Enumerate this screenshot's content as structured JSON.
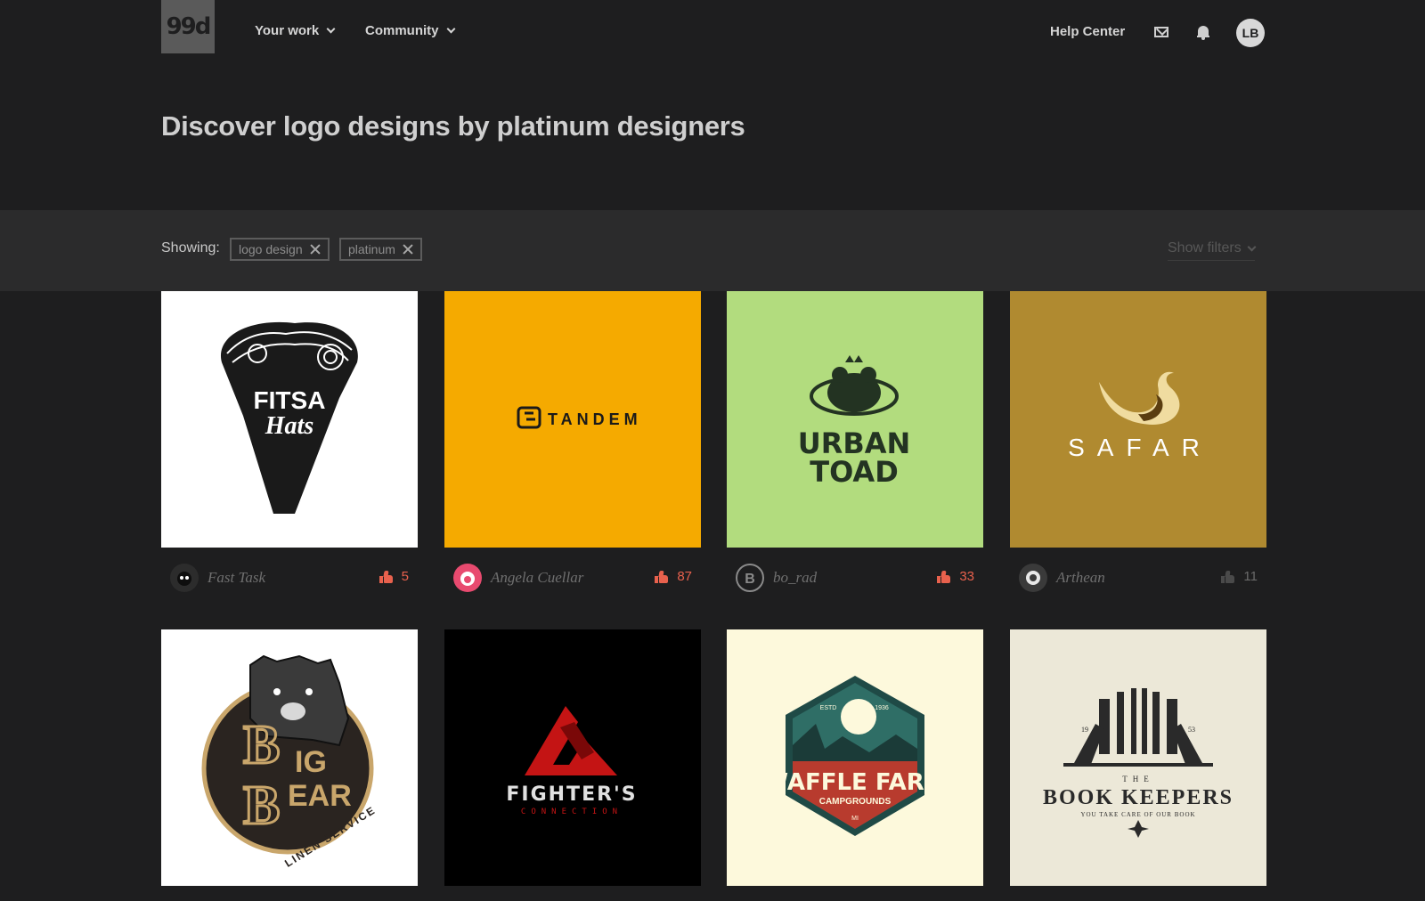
{
  "header": {
    "logo_text": "99d",
    "nav": [
      {
        "label": "Your work"
      },
      {
        "label": "Community"
      }
    ],
    "help_label": "Help Center",
    "icons": [
      "mail-icon",
      "bell-icon"
    ],
    "avatar_initials": "LB"
  },
  "page": {
    "title": "Discover logo designs by platinum designers"
  },
  "filters": {
    "showing_label": "Showing:",
    "chips": [
      "logo design",
      "platinum"
    ],
    "show_filters_label": "Show filters"
  },
  "designs": [
    {
      "designer": "Fast Task",
      "likes": "5",
      "bg": "#ffffff",
      "logo_text": "FITSA",
      "logo_text2": "Hats"
    },
    {
      "designer": "Angela Cuellar",
      "likes": "87",
      "bg": "#f5aa00",
      "logo_text": "TANDEM"
    },
    {
      "designer": "bo_rad",
      "likes": "33",
      "bg": "#b2dc7e",
      "logo_text": "URBAN",
      "logo_text2": "TOAD"
    },
    {
      "designer": "Arthean",
      "likes": "11",
      "bg": "#b08a30",
      "logo_text": "SAFAR"
    },
    {
      "bg": "#ffffff",
      "logo_text": "IG",
      "logo_text2": "EAR",
      "logo_text3": "LINEN SERVICE"
    },
    {
      "bg": "#000000",
      "logo_text": "FIGHTER'S",
      "logo_text2": "CONNECTION"
    },
    {
      "bg": "#fdf9dc",
      "logo_text": "WAFFLE FARM",
      "logo_text2": "CAMPGROUNDS",
      "logo_text3": "ESTD",
      "logo_text4": "1936",
      "logo_text5": "MI"
    },
    {
      "bg": "#ece8d8",
      "logo_text": "BOOK KEEPERS",
      "logo_text2": "THE",
      "logo_text3": "YOU TAKE CARE OF OUR BOOK",
      "logo_text4": "19",
      "logo_text5": "53"
    }
  ],
  "colors": {
    "background": "#1e1e1f",
    "filter_bar": "#2b2b2c",
    "like_active": "#e8614d"
  }
}
